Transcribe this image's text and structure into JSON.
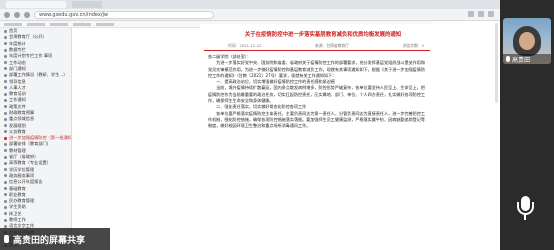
{
  "browser": {
    "url": "www.gsedu.gov.cn/index/jw",
    "tabs": [
      "",
      ""
    ]
  },
  "sidebar": {
    "items": [
      {
        "label": "首页",
        "active": false
      },
      {
        "label": "甘肃教育厅（公开）",
        "active": false
      },
      {
        "label": "年度统计",
        "active": false
      },
      {
        "label": "数据专栏",
        "active": false
      },
      {
        "label": "年度计划专栏工作 事项",
        "active": false
      },
      {
        "label": "工作动态",
        "active": false
      },
      {
        "label": "部门通知",
        "active": false
      },
      {
        "label": "部署工作情况（教研、学生...）",
        "active": false
      },
      {
        "label": "领导信息",
        "active": false
      },
      {
        "label": "人事人才",
        "active": false
      },
      {
        "label": "教育培训",
        "active": false
      },
      {
        "label": "工作通知",
        "active": false
      },
      {
        "label": "政策文件",
        "active": false
      },
      {
        "label": "财政教育预算",
        "active": false
      },
      {
        "label": "重点领域信息",
        "active": false
      },
      {
        "label": "发展规划",
        "active": false
      },
      {
        "label": "义务教育",
        "active": false
      },
      {
        "label": "进一步加强疫情防控（第一批通知）",
        "active": true
      },
      {
        "label": "部署安排（教育部门）",
        "active": false
      },
      {
        "label": "教材管理",
        "active": false
      },
      {
        "label": "省厅（省政府）",
        "active": false
      },
      {
        "label": "高等教育（专业设置）",
        "active": false
      },
      {
        "label": "学历学位管理",
        "active": false
      },
      {
        "label": "政务服务事项",
        "active": false
      },
      {
        "label": "信息公开年度报告",
        "active": false
      },
      {
        "label": "基础教育",
        "active": false
      },
      {
        "label": "职业教育",
        "active": false
      },
      {
        "label": "民办教育管理",
        "active": false
      },
      {
        "label": "学生资助",
        "active": false
      },
      {
        "label": "体卫艺",
        "active": false
      },
      {
        "label": "教师工作",
        "active": false
      },
      {
        "label": "语言文字工作",
        "active": false
      },
      {
        "label": "信息公开指南",
        "active": false
      },
      {
        "label": "依申请公开",
        "active": false
      },
      {
        "label": "其他",
        "active": false
      }
    ]
  },
  "document": {
    "title": "关于在疫情防控中进一步落实基层教育减负和优质均衡发展的通知",
    "date": "时间：2021-12-22",
    "source": "来源：甘肃省教育厅",
    "views": "浏览次数：3",
    "paragraphs": [
      "各二级学院（部处室）：",
      "　　为进一步落实好党中央、国务院和省委、省政府关于疫情防控工作的部署要求，充分发挥基层党组织战斗堡垒作用和党员先锋模范作用，为进一步做好疫情防控和基层教育减负工作，现就有关事项通知如下。根据《关于进一步加强疫情防控工作的通知》（甘教〔2021〕27号）要求，现就有关工作通知如下：",
      "　　一、提高政治站位，切实增强做好疫情防控工作的责任感和紧迫感",
      "　　当前，境外疫情持续扩散蔓延，国内多点散发病例增多，防控形势严峻复杂，各单位要坚持人民至上、生命至上，把疫情防控作为当前最重要的政治任务，切实扛起防控责任，压实属地、部门、单位、个人四方责任，扎实做好各项防控工作，确保师生生命安全和身体健康。",
      "　　二、强化责任落实，切实做好常态化防控各项工作",
      "　　各单位要严格落实疫情防控主体责任，主要负责同志为第一责任人，分管负责同志为直接责任人，进一步完善防控工作机制，细化防控措施，确保各项防控措施落实落细。要加强师生员工健康监测，严格落实晨午检、因病缺勤追踪登记等制度，做好校园环境卫生整治和重点场所消毒通风工作。"
    ]
  },
  "camera": {
    "user_name": "高贵田"
  },
  "share": {
    "label": "高贵田的屏幕共享"
  },
  "colors": {
    "title_red": "#d0201f",
    "sidebar_bg": "#f3f4f6"
  }
}
